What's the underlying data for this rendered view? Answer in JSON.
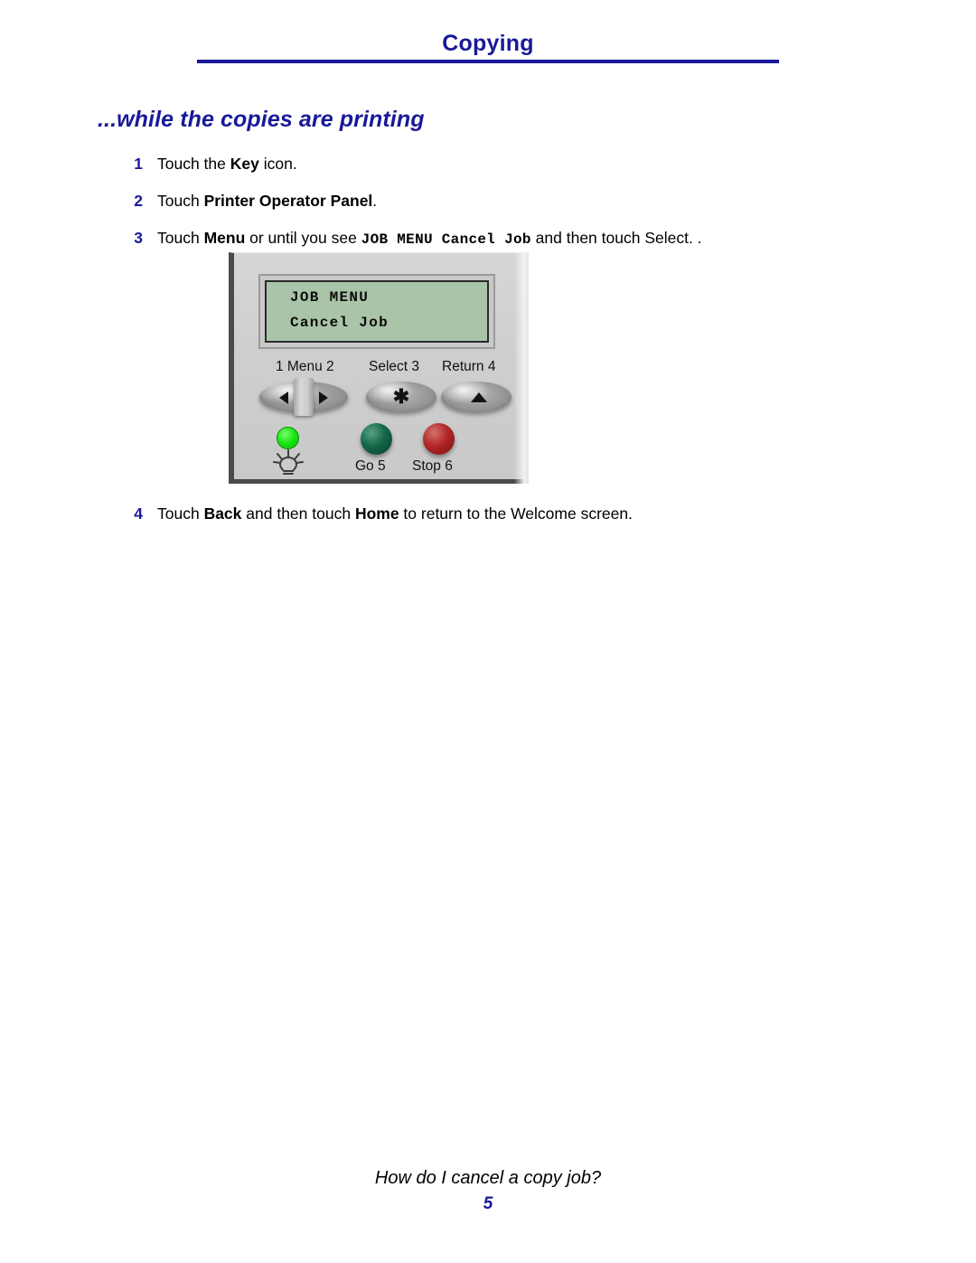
{
  "header": {
    "title": "Copying"
  },
  "section": {
    "heading": "...while the copies are printing"
  },
  "steps": [
    {
      "num": "1",
      "pre": "Touch the ",
      "bold": "Key",
      "post": " icon."
    },
    {
      "num": "2",
      "pre": "Touch ",
      "bold": "Printer Operator Panel",
      "post": "."
    },
    {
      "num": "3",
      "pre": "Touch ",
      "bold": "Menu",
      "mid": " or until you see ",
      "mono": "JOB MENU Cancel Job",
      "post": " and then  touch Select. ."
    }
  ],
  "step4": {
    "num": "4",
    "pre": "Touch ",
    "bold1": "Back",
    "mid": " and then touch ",
    "bold2": "Home",
    "post": " to return to the Welcome screen."
  },
  "panel": {
    "lcd": {
      "line1": "JOB MENU",
      "line2": "Cancel Job"
    },
    "labels": {
      "menu": "1 Menu 2",
      "select": "Select 3",
      "return": "Return 4",
      "go": "Go 5",
      "stop": "Stop 6"
    },
    "glyphs": {
      "select_star": "✱"
    },
    "colors": {
      "lcd_screen": "#a9c4a8",
      "body": "#d0d0d0",
      "led_green": "#19e515",
      "go_green": "#14684a",
      "stop_red": "#b22626"
    }
  },
  "footer": {
    "caption": "How do I cancel a copy job?",
    "page_number": "5"
  },
  "theme": {
    "accent_blue": "#191999"
  }
}
